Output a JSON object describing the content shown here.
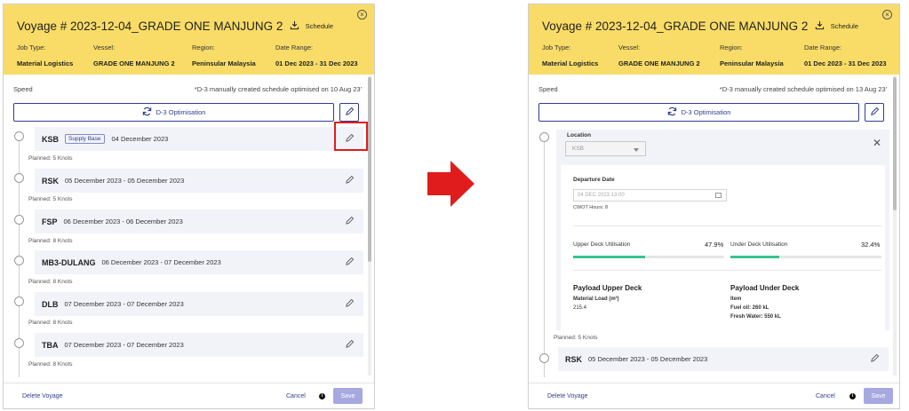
{
  "left": {
    "title": "Voyage # 2023-12-04_GRADE ONE MANJUNG 2",
    "schedule_label": "Schedule",
    "meta": [
      {
        "label": "Job Type:",
        "value": "Material Logistics"
      },
      {
        "label": "Vessel:",
        "value": "GRADE ONE MANJUNG 2"
      },
      {
        "label": "Region:",
        "value": "Peninsular Malaysia"
      },
      {
        "label": "Date Range:",
        "value": "01 Dec 2023 - 31 Dec 2023"
      }
    ],
    "speed_label": "Speed",
    "note": "*D-3 manually created schedule optimised on 10 Aug 23'",
    "optimisation_label": "D-3 Optimisation",
    "stops": [
      {
        "code": "KSB",
        "badge": "Supply Base",
        "dates": "04 December 2023",
        "planned": "Planned: 5 Knots"
      },
      {
        "code": "RSK",
        "badge": "",
        "dates": "05 December 2023 - 05 December 2023",
        "planned": "Planned: 5 Knots"
      },
      {
        "code": "FSP",
        "badge": "",
        "dates": "06 December 2023 - 06 December 2023",
        "planned": "Planned: 8 Knots"
      },
      {
        "code": "MB3-DULANG",
        "badge": "",
        "dates": "06 December 2023 - 07 December 2023",
        "planned": "Planned: 8 Knots"
      },
      {
        "code": "DLB",
        "badge": "",
        "dates": "07 December 2023 - 07 December 2023",
        "planned": "Planned: 8 Knots"
      },
      {
        "code": "TBA",
        "badge": "",
        "dates": "07 December 2023 - 07 December 2023",
        "planned": "Planned: 8 Knots"
      }
    ],
    "footer": {
      "delete_label": "Delete Voyage",
      "cancel_label": "Cancel",
      "save_label": "Save"
    }
  },
  "right": {
    "title": "Voyage # 2023-12-04_GRADE ONE MANJUNG 2",
    "schedule_label": "Schedule",
    "meta": [
      {
        "label": "Job Type:",
        "value": "Material Logistics"
      },
      {
        "label": "Vessel:",
        "value": "GRADE ONE MANJUNG 2"
      },
      {
        "label": "Region:",
        "value": "Peninsular Malaysia"
      },
      {
        "label": "Date Range:",
        "value": "01 Dec 2023 - 31 Dec 2023"
      }
    ],
    "speed_label": "Speed",
    "note": "*D-3 manually created schedule optimised on 13 Aug 23'",
    "optimisation_label": "D-3 Optimisation",
    "expanded": {
      "location_label": "Location",
      "location_value": "KSB",
      "departure_label": "Departure Date",
      "departure_value": "04 DEC 2023 13:00",
      "cwot": "CWOT Hours: 8",
      "upper_label": "Upper Deck Utilisation",
      "upper_value": "47.9%",
      "upper_fraction": 0.479,
      "under_label": "Under Deck Utilisation",
      "under_value": "32.4%",
      "under_fraction": 0.324,
      "payload_upper_title": "Payload Upper Deck",
      "payload_upper_sub": "Material Load (m³)",
      "payload_upper_value": "215.4",
      "payload_under_title": "Payload Under Deck",
      "payload_under_sub": "Item",
      "payload_under_line1": "Fuel oil: 260 kL",
      "payload_under_line2": "Fresh Water: 550 kL",
      "planned": "Planned: 5 Knots"
    },
    "next_stop": {
      "code": "RSK",
      "dates": "05 December 2023 - 05 December 2023"
    },
    "footer": {
      "delete_label": "Delete Voyage",
      "cancel_label": "Cancel",
      "save_label": "Save"
    }
  },
  "icons": {
    "schedule": "download-schedule-icon",
    "optimisation": "refresh-icon",
    "edit": "pencil-icon",
    "close": "close-icon",
    "info": "info-icon",
    "arrow": "right-arrow-icon"
  },
  "colors": {
    "header": "#f9dc67",
    "accent": "#2f3d8f",
    "save": "#a6a9e0",
    "highlight": "#e01c1c",
    "progress": "#37c48f",
    "arrow": "#e01c1c"
  }
}
